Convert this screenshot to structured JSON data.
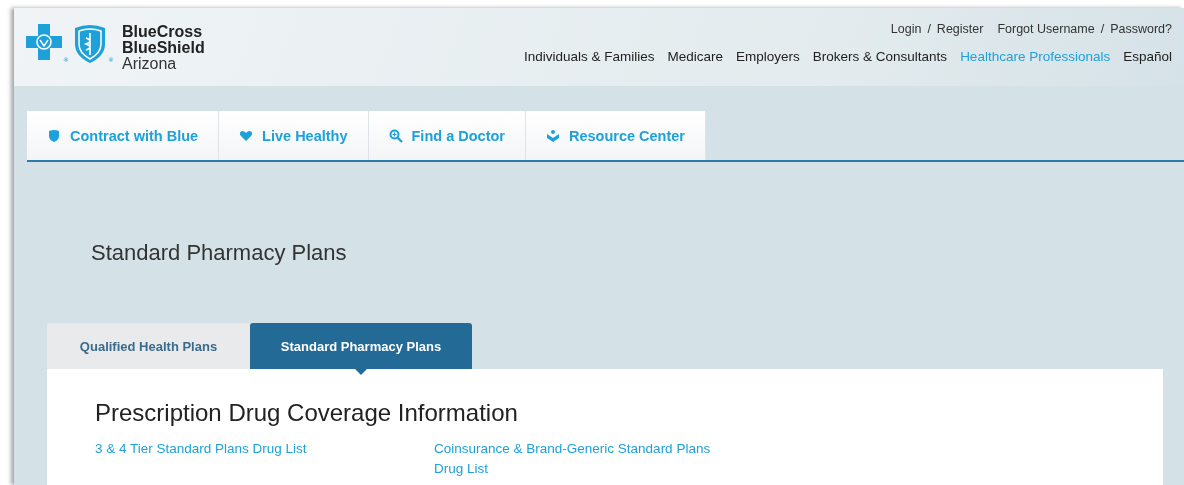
{
  "logo": {
    "lines": [
      "BlueCross",
      "BlueShield",
      "Arizona"
    ],
    "registered_marks": [
      "®",
      "®"
    ]
  },
  "utility_links": [
    {
      "kind": "link",
      "text": "Login"
    },
    {
      "kind": "separator",
      "text": "/"
    },
    {
      "kind": "link",
      "text": "Register"
    },
    {
      "kind": "link",
      "text": "Forgot Username"
    },
    {
      "kind": "separator",
      "text": "/"
    },
    {
      "kind": "link",
      "text": "Password?"
    }
  ],
  "main_nav": [
    {
      "label": "Individuals & Families",
      "selected": false
    },
    {
      "label": "Medicare",
      "selected": false
    },
    {
      "label": "Employers",
      "selected": false
    },
    {
      "label": "Brokers & Consultants",
      "selected": false
    },
    {
      "label": "Healthcare Professionals",
      "selected": true
    },
    {
      "label": "Español",
      "selected": false
    }
  ],
  "section_nav": [
    {
      "kind": "shield",
      "label": "Contract with Blue"
    },
    {
      "kind": "heart",
      "label": "Live Healthy"
    },
    {
      "kind": "search",
      "label": "Find a Doctor"
    },
    {
      "kind": "hands",
      "label": "Resource Center"
    }
  ],
  "page_title": "Standard Pharmacy Plans",
  "plan_tabs": [
    {
      "label": "Qualified Health Plans",
      "selected": false
    },
    {
      "label": "Standard Pharmacy Plans",
      "selected": true
    }
  ],
  "content": {
    "heading": "Prescription Drug Coverage Information",
    "links": [
      "3 & 4 Tier Standard Plans Drug List",
      "Coinsurance & Brand-Generic Standard Plans Drug List"
    ]
  }
}
